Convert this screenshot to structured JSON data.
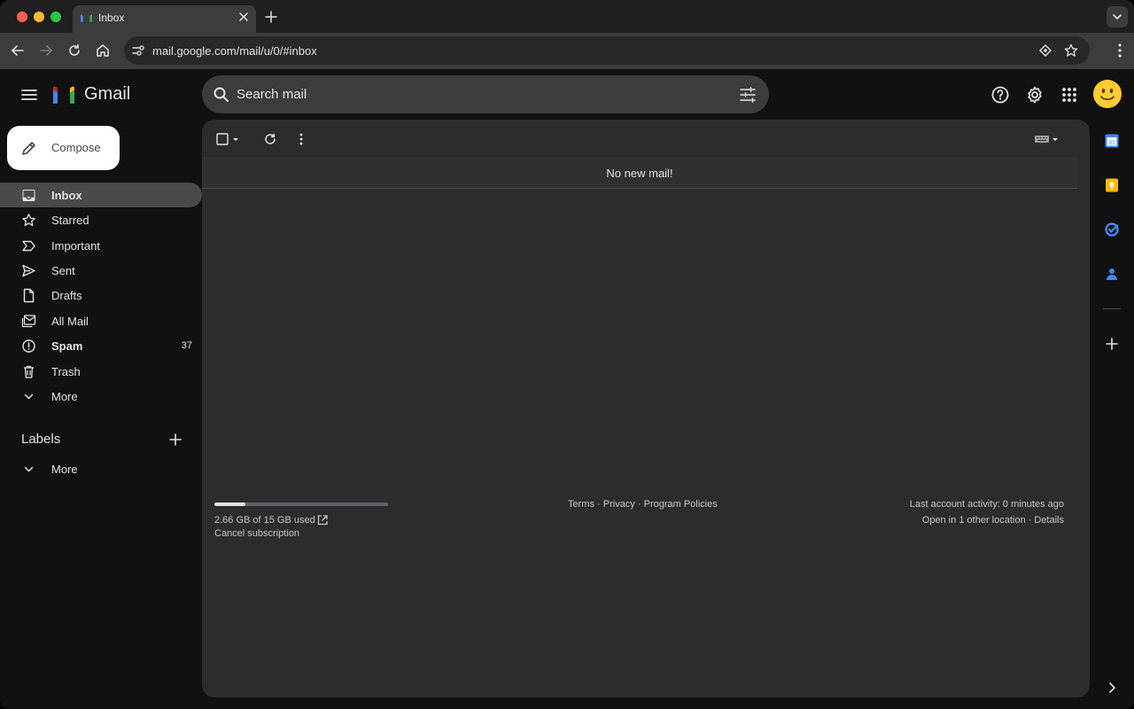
{
  "browser": {
    "tab_title": "Inbox",
    "url": "mail.google.com/mail/u/0/#inbox"
  },
  "app": {
    "name": "Gmail",
    "search_placeholder": "Search mail"
  },
  "compose_label": "Compose",
  "nav": [
    {
      "label": "Inbox",
      "icon": "inbox-icon",
      "active": true
    },
    {
      "label": "Starred",
      "icon": "star-icon"
    },
    {
      "label": "Important",
      "icon": "important-icon"
    },
    {
      "label": "Sent",
      "icon": "send-icon"
    },
    {
      "label": "Drafts",
      "icon": "draft-icon"
    },
    {
      "label": "All Mail",
      "icon": "all-mail-icon"
    },
    {
      "label": "Spam",
      "icon": "spam-icon",
      "count": "37",
      "bold": true
    },
    {
      "label": "Trash",
      "icon": "trash-icon"
    },
    {
      "label": "More",
      "icon": "chevron-down-icon"
    }
  ],
  "labels": {
    "title": "Labels",
    "more": "More"
  },
  "main": {
    "empty_message": "No new mail!",
    "storage": {
      "used_fraction": 0.177,
      "text": "2.66 GB of 15 GB used",
      "cancel": "Cancel subscription"
    },
    "footer_links": {
      "terms": "Terms",
      "privacy": "Privacy",
      "policies": "Program Policies",
      "sep": "·"
    },
    "activity": {
      "last": "Last account activity: 0 minutes ago",
      "other": "Open in 1 other location",
      "details": "Details"
    }
  },
  "right_rail": {
    "calendar_day": "31"
  },
  "colors": {
    "background": "#111111",
    "panel": "#2c2c2c",
    "search": "#3c3c3c",
    "active_nav": "#4a4a4a",
    "text": "#e3e3e3"
  }
}
